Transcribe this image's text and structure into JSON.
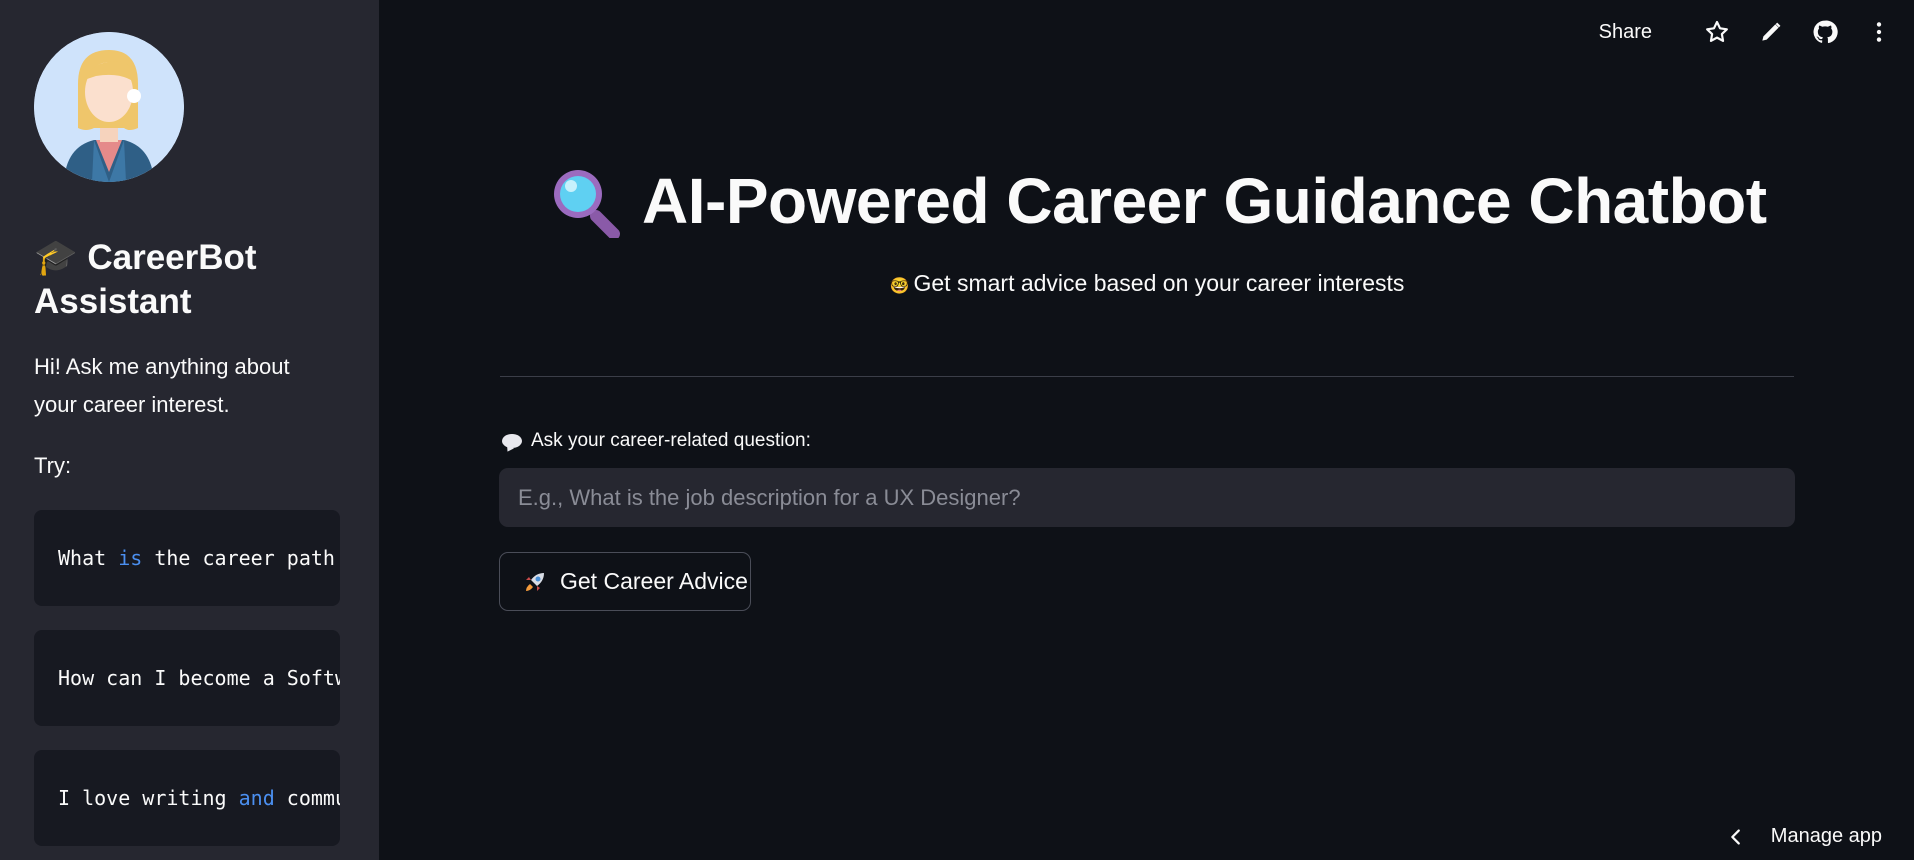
{
  "sidebar": {
    "title_emoji": "🎓",
    "title": "CareerBot Assistant",
    "intro": "Hi! Ask me anything about your career interest.",
    "try_label": "Try:",
    "examples": [
      {
        "pre": "What ",
        "kw": "is",
        "post": " the career path for a Data Scientist?"
      },
      {
        "pre": "How can I become a Software Engineer?",
        "kw": "",
        "post": ""
      },
      {
        "pre": "I love writing ",
        "kw": "and",
        "post": " communication skills"
      }
    ]
  },
  "toolbar": {
    "share_label": "Share",
    "icons": [
      "star-icon",
      "pencil-icon",
      "github-icon",
      "more-vertical-icon"
    ]
  },
  "main": {
    "title": "AI-Powered Career Guidance Chatbot",
    "subtitle_emoji": "🤓",
    "subtitle": "Get smart advice based on your career interests",
    "input_label": "Ask your career-related question:",
    "input_value": "",
    "input_placeholder": "E.g., What is the job description for a UX Designer?",
    "button_label": "Get Career Advice"
  },
  "footer": {
    "manage_label": "Manage app"
  },
  "colors": {
    "background": "#0e1117",
    "sidebar": "#262730",
    "keyword": "#4b8ff0"
  }
}
